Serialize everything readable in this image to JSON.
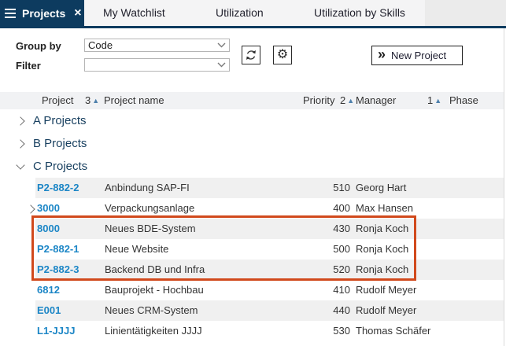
{
  "tab_bar": {
    "active_tab": "Projects",
    "tabs": [
      "My Watchlist",
      "Utilization",
      "Utilization by Skills"
    ]
  },
  "toolbar": {
    "group_by": {
      "label": "Group by",
      "value": "Code"
    },
    "filter": {
      "label": "Filter",
      "value": ""
    },
    "new_project": {
      "label": "New Project"
    }
  },
  "table": {
    "columns": [
      {
        "label": "Project",
        "sort_order": "3"
      },
      {
        "label": "Project name",
        "sort_order": ""
      },
      {
        "label": "Priority",
        "sort_order": "2"
      },
      {
        "label": "Manager",
        "sort_order": "1"
      },
      {
        "label": "Phase",
        "sort_order": ""
      }
    ],
    "groups": [
      {
        "label": "A Projects",
        "expanded": false
      },
      {
        "label": "B Projects",
        "expanded": false
      },
      {
        "label": "C Projects",
        "expanded": true
      }
    ],
    "rows": [
      {
        "id": "P2-882-2",
        "name": "Anbindung SAP-FI",
        "priority": "510",
        "manager": "Georg Hart",
        "phase": "",
        "expandable": false
      },
      {
        "id": "3000",
        "name": "Verpackungsanlage",
        "priority": "400",
        "manager": "Max Hansen",
        "phase": "",
        "expandable": true
      },
      {
        "id": "8000",
        "name": "Neues BDE-System",
        "priority": "430",
        "manager": "Ronja Koch",
        "phase": "",
        "expandable": false
      },
      {
        "id": "P2-882-1",
        "name": "Neue Website",
        "priority": "500",
        "manager": "Ronja Koch",
        "phase": "",
        "expandable": false
      },
      {
        "id": "P2-882-3",
        "name": "Backend DB und Infra",
        "priority": "520",
        "manager": "Ronja Koch",
        "phase": "",
        "expandable": false
      },
      {
        "id": "6812",
        "name": "Bauprojekt - Hochbau",
        "priority": "410",
        "manager": "Rudolf Meyer",
        "phase": "",
        "expandable": false
      },
      {
        "id": "E001",
        "name": "Neues CRM-System",
        "priority": "440",
        "manager": "Rudolf Meyer",
        "phase": "",
        "expandable": false
      },
      {
        "id": "L1-JJJJ",
        "name": "Linientätigkeiten JJJJ",
        "priority": "530",
        "manager": "Thomas Schäfer",
        "phase": "",
        "expandable": false
      }
    ]
  },
  "highlight_box": {
    "color": "#d1491c",
    "rows_enclosed": [
      "8000",
      "P2-882-1",
      "P2-882-3"
    ]
  },
  "icons": {
    "close": "×",
    "settings": "⚙",
    "sort_asc": "▲",
    "new_project_chevrons": "»"
  },
  "colors": {
    "navy": "#0d3b5f",
    "link_blue": "#1c86c6",
    "group_text": "#173f5f",
    "sort_arrow": "#4e80ac",
    "header_bg": "#f1f2f4",
    "alt_row_bg": "#f0f0f0"
  }
}
